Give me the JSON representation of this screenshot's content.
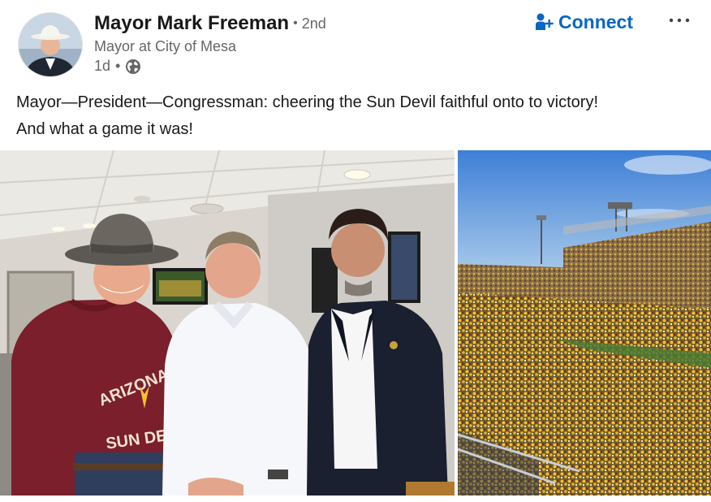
{
  "post": {
    "author": {
      "name": "Mayor Mark Freeman",
      "separator": "•",
      "degree": "2nd",
      "headline": "Mayor at City of Mesa",
      "time": "1d",
      "meta_separator": "•",
      "visibility_icon": "globe-icon"
    },
    "actions": {
      "connect_label": "Connect",
      "connect_icon": "add-person-icon",
      "more_icon": "more-options-icon"
    },
    "text_line1": "Mayor—President—Congressman: cheering the Sun Devil faithful onto to victory!",
    "text_line2": "And what a game it was!",
    "images": [
      {
        "shirt_text_top": "ARIZONA ST",
        "shirt_text_bottom": "SUN DEV"
      },
      {}
    ]
  },
  "colors": {
    "link_blue": "#0a66c2",
    "text_primary": "#191919",
    "text_secondary": "#666666",
    "asu_maroon": "#7a1f2b",
    "asu_gold": "#f2c230"
  }
}
